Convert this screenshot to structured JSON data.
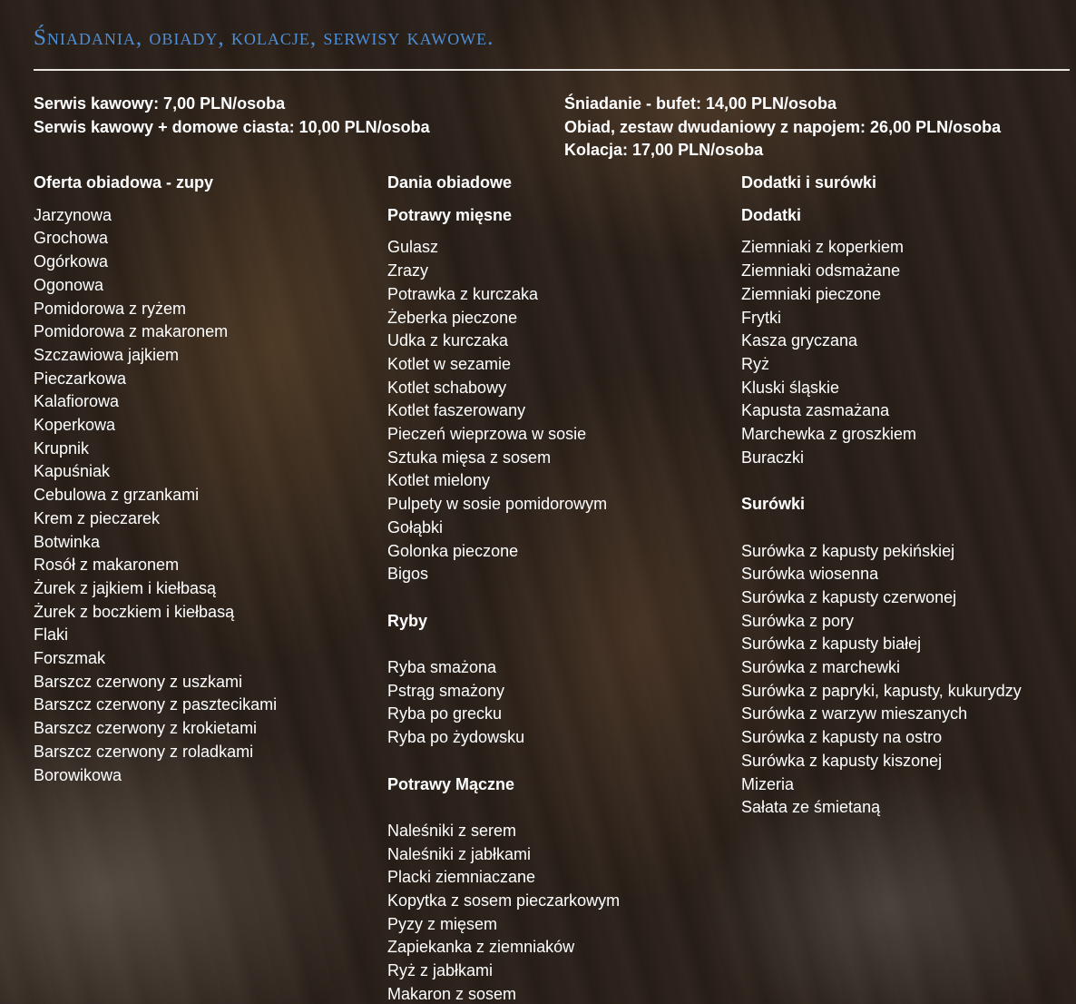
{
  "title": "Śniadania, obiady, kolacje, serwisy kawowe.",
  "prices_left": [
    "Serwis kawowy: 7,00 PLN/osoba",
    "Serwis kawowy + domowe ciasta: 10,00 PLN/osoba"
  ],
  "prices_right": [
    "Śniadanie - bufet: 14,00 PLN/osoba",
    "Obiad, zestaw dwudaniowy z napojem: 26,00 PLN/osoba",
    "Kolacja: 17,00 PLN/osoba"
  ],
  "soups": {
    "heading": "Oferta obiadowa - zupy",
    "items": [
      "Jarzynowa",
      "Grochowa",
      "Ogórkowa",
      "Ogonowa",
      "Pomidorowa z ryżem",
      "Pomidorowa z makaronem",
      "Szczawiowa jajkiem",
      "Pieczarkowa",
      "Kalafiorowa",
      "Koperkowa",
      "Krupnik",
      "Kapuśniak",
      "Cebulowa z grzankami",
      "Krem z pieczarek",
      "Botwinka",
      "Rosół z makaronem",
      "Żurek z jajkiem i kiełbasą",
      "Żurek z boczkiem i kiełbasą",
      "Flaki",
      "Forszmak",
      "Barszcz czerwony z uszkami",
      "Barszcz czerwony z pasztecikami",
      "Barszcz czerwony z krokietami",
      "Barszcz czerwony z roladkami",
      "Borowikowa"
    ]
  },
  "mains": {
    "heading": "Dania obiadowe",
    "meat": {
      "heading": "Potrawy mięsne",
      "items": [
        "Gulasz",
        "Zrazy",
        "Potrawka z kurczaka",
        "Żeberka pieczone",
        "Udka z kurczaka",
        "Kotlet w sezamie",
        "Kotlet schabowy",
        "Kotlet faszerowany",
        "Pieczeń wieprzowa w sosie",
        "Sztuka mięsa z sosem",
        "Kotlet mielony",
        "Pulpety w sosie pomidorowym",
        "Gołąbki",
        "Golonka pieczone",
        "Bigos"
      ]
    },
    "fish": {
      "heading": "Ryby",
      "items": [
        "Ryba smażona",
        "Pstrąg smażony",
        "Ryba po grecku",
        "Ryba po żydowsku"
      ]
    },
    "flour": {
      "heading": "Potrawy Mączne",
      "items": [
        "Naleśniki z serem",
        "Naleśniki z jabłkami",
        "Placki ziemniaczane",
        "Kopytka z sosem pieczarkowym",
        "Pyzy z mięsem",
        "Zapiekanka z ziemniaków",
        "Ryż z jabłkami",
        "Makaron z sosem"
      ]
    }
  },
  "sides": {
    "heading": "Dodatki i surówki",
    "extras": {
      "heading": "Dodatki",
      "items": [
        "Ziemniaki z koperkiem",
        "Ziemniaki odsmażane",
        "Ziemniaki pieczone",
        "Frytki",
        "Kasza gryczana",
        "Ryż",
        "Kluski śląskie",
        "Kapusta zasmażana",
        "Marchewka z groszkiem",
        "Buraczki"
      ]
    },
    "salads": {
      "heading": "Surówki",
      "items": [
        "Surówka z kapusty pekińskiej",
        "Surówka wiosenna",
        "Surówka z kapusty czerwonej",
        "Surówka z pory",
        "Surówka z kapusty białej",
        "Surówka z marchewki",
        "Surówka z papryki, kapusty, kukurydzy",
        "Surówka z warzyw mieszanych",
        "Surówka z kapusty na ostro",
        "Surówka z kapusty kiszonej",
        "Mizeria",
        "Sałata ze śmietaną"
      ]
    }
  },
  "colors": {
    "title": "#4d8fd6",
    "text": "#ffffff",
    "rule": "#e8e6e3"
  }
}
